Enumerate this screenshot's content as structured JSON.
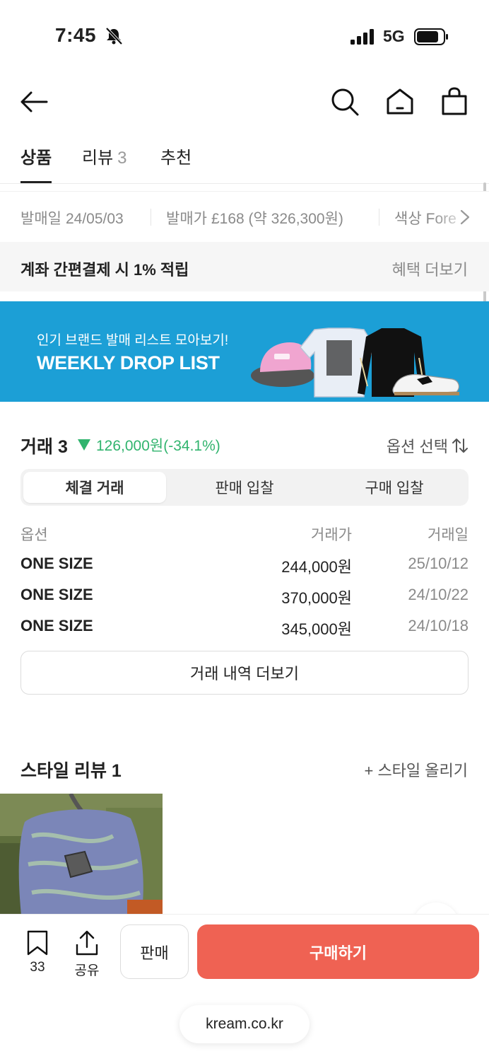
{
  "status": {
    "time": "7:45",
    "network": "5G"
  },
  "tabs": [
    {
      "label": "상품",
      "count": ""
    },
    {
      "label": "리뷰",
      "count": "3"
    },
    {
      "label": "추천",
      "count": ""
    }
  ],
  "info": {
    "release_label": "발매일",
    "release_value": "24/05/03",
    "price_label": "발매가",
    "price_value": "£168 (약 326,300원)",
    "color_label": "색상",
    "color_value": "Fore"
  },
  "benefit": {
    "text": "계좌 간편결제 시 1% 적립",
    "more": "혜택 더보기"
  },
  "banner": {
    "subtitle": "인기 브랜드 발매 리스트 모아보기!",
    "title": "WEEKLY DROP LIST"
  },
  "trade": {
    "title": "거래 3",
    "change": "126,000원(-34.1%)",
    "option_select": "옵션 선택",
    "segments": [
      "체결 거래",
      "판매 입찰",
      "구매 입찰"
    ],
    "columns": [
      "옵션",
      "거래가",
      "거래일"
    ],
    "rows": [
      {
        "option": "ONE SIZE",
        "price": "244,000원",
        "date": "25/10/12"
      },
      {
        "option": "ONE SIZE",
        "price": "370,000원",
        "date": "24/10/22"
      },
      {
        "option": "ONE SIZE",
        "price": "345,000원",
        "date": "24/10/18"
      }
    ],
    "more": "거래 내역 더보기"
  },
  "style": {
    "title": "스타일 리뷰 1",
    "upload": "+ 스타일 올리기"
  },
  "bottom": {
    "bookmark_count": "33",
    "share_label": "공유",
    "sell_label": "판매",
    "buy_label": "구매하기",
    "url": "kream.co.kr"
  },
  "colors": {
    "accent_buy": "#ef6253",
    "positive_green": "#31b46e",
    "banner_blue": "#1c9fd6"
  }
}
